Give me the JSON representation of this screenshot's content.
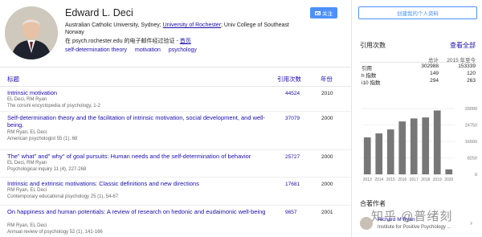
{
  "profile": {
    "name": "Edward L. Deci",
    "affiliation_pre": "Australian Catholic University, Sydney; ",
    "affiliation_link": "University of Rochester",
    "affiliation_post": "; Univ College of Southeast Norway",
    "email_text": "在 psych.rochester.edu 的电子邮件经过验证 - ",
    "homepage": "首页",
    "tags": [
      "self-determination theory",
      "motivation",
      "psychology"
    ],
    "follow_label": "关注"
  },
  "table": {
    "header_title": "标题",
    "header_cited": "引用次数",
    "header_year": "年份",
    "rows": [
      {
        "title": "Intrinsic motivation",
        "authors": "EL Deci, RM Ryan",
        "venue": "The corsini encyclopedia of psychology, 1-2",
        "cited": "44524",
        "year": "2010"
      },
      {
        "title": "Self-determination theory and the facilitation of intrinsic motivation, social development, and well-being.",
        "authors": "RM Ryan, EL Deci",
        "venue": "American psychologist 55 (1), 68",
        "cited": "37079",
        "year": "2000"
      },
      {
        "title": "The\" what\" and\" why\" of goal pursuits: Human needs and the self-determination of behavior",
        "authors": "EL Deci, RM Ryan",
        "venue": "Psychological inquiry 11 (4), 227-268",
        "cited": "25727",
        "year": "2000"
      },
      {
        "title": "Intrinsic and extrinsic motivations: Classic definitions and new directions",
        "authors": "RM Ryan, EL Deci",
        "venue": "Contemporary educational psychology 25 (1), 54-67",
        "cited": "17681",
        "year": "2000"
      },
      {
        "title": "On happiness and human potentials: A review of research on hedonic and eudaimonic well-being",
        "authors": "RM Ryan, EL Deci",
        "venue": "Annual review of psychology 52 (1), 141-166",
        "cited": "9657",
        "year": "2001"
      }
    ]
  },
  "sidebar": {
    "create_profile": "创建我的个人资料",
    "cited_by": "引用次数",
    "view_all": "查看全部",
    "stats_header": {
      "all": "总计",
      "since": "2015 年至今"
    },
    "stats": [
      {
        "label": "引用",
        "all": "302988",
        "since": "153339"
      },
      {
        "label": "h 指数",
        "all": "149",
        "since": "120"
      },
      {
        "label": "i10 指数",
        "all": "294",
        "since": "263"
      }
    ],
    "coauthors_title": "合著作者",
    "coauthor": {
      "name": "Richard M Ryan",
      "institution": "Institute for Positive Psychology ..."
    },
    "watermark": "知乎 @普绪刻"
  },
  "chart_data": {
    "type": "bar",
    "categories": [
      "2013",
      "2014",
      "2015",
      "2016",
      "2017",
      "2018",
      "2019",
      "2020"
    ],
    "values": [
      18500,
      20500,
      22500,
      26500,
      28000,
      28500,
      32000,
      2500
    ],
    "y_ticks": [
      "33000",
      "24750",
      "16500",
      "8250",
      "0"
    ],
    "ylim": [
      0,
      33000
    ],
    "bar_color": "#777777"
  }
}
